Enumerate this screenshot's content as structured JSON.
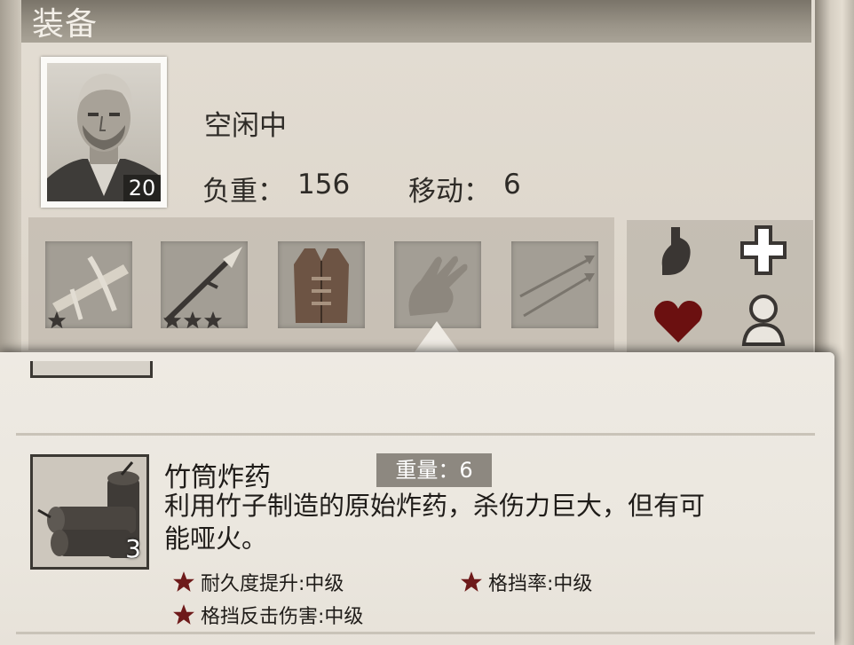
{
  "header": {
    "title": "装备"
  },
  "character": {
    "level": "20",
    "status": "空闲中",
    "load_label": "负重：",
    "load_value": "156",
    "move_label": "移动：",
    "move_value": "6"
  },
  "equipment_slots": [
    {
      "icon": "crossbow-icon",
      "stars": 1
    },
    {
      "icon": "spear-icon",
      "stars": 3
    },
    {
      "icon": "leather-vest-icon",
      "stars": 0
    },
    {
      "icon": "hand-icon",
      "stars": 0
    },
    {
      "icon": "arrows-icon",
      "stars": 0
    }
  ],
  "stats_icons": [
    "stomach-icon",
    "cross-icon",
    "heart-icon",
    "person-icon"
  ],
  "item": {
    "name": "竹筒炸药",
    "weight_label": "重量：6",
    "count": "3",
    "desc_line1": "利用竹子制造的原始炸药，杀伤力巨大，但有可",
    "desc_line2": "能哑火。",
    "attributes": [
      "耐久度提升:中级",
      "格挡率:中级",
      "格挡反击伤害:中级"
    ]
  },
  "colors": {
    "star": "#6e1a1a",
    "heart": "#6b1010",
    "weight_badge": "#8d8880"
  }
}
